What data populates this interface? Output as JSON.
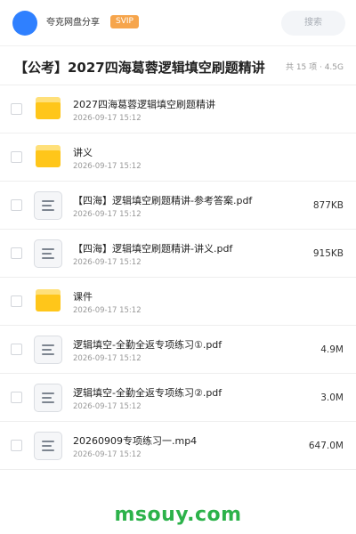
{
  "header": {
    "app_name": "夸克网盘分享",
    "badge": "SVIP",
    "search_placeholder": "搜索"
  },
  "share": {
    "title": "【公考】2027四海葛蓉逻辑填空刷题精讲",
    "meta": "共 15 项 · 4.5G"
  },
  "files": [
    {
      "type": "folder",
      "icon": "folder-icon",
      "name": "2027四海葛蓉逻辑填空刷题精讲",
      "time": "2026-09-17 15:12",
      "size": ""
    },
    {
      "type": "folder",
      "icon": "folder-icon",
      "name": "讲义",
      "time": "2026-09-17 15:12",
      "size": ""
    },
    {
      "type": "file",
      "icon": "document-icon",
      "name": "【四海】逻辑填空刷题精讲-参考答案.pdf",
      "time": "2026-09-17 15:12",
      "size": "877KB"
    },
    {
      "type": "file",
      "icon": "document-icon",
      "name": "【四海】逻辑填空刷题精讲-讲义.pdf",
      "time": "2026-09-17 15:12",
      "size": "915KB"
    },
    {
      "type": "folder",
      "icon": "folder-icon",
      "name": "课件",
      "time": "2026-09-17 15:12",
      "size": ""
    },
    {
      "type": "file",
      "icon": "document-icon",
      "name": "逻辑填空-全勤全返专项练习①.pdf",
      "time": "2026-09-17 15:12",
      "size": "4.9M"
    },
    {
      "type": "file",
      "icon": "document-icon",
      "name": "逻辑填空-全勤全返专项练习②.pdf",
      "time": "2026-09-17 15:12",
      "size": "3.0M"
    },
    {
      "type": "file",
      "icon": "document-icon",
      "name": "20260909专项练习一.mp4",
      "time": "2026-09-17 15:12",
      "size": "647.0M"
    }
  ],
  "watermark": "msouy.com",
  "colors": {
    "accent": "#2f80ff",
    "badge": "#f6a54c",
    "folder": "#ffc61a",
    "watermark": "#2cb24a"
  }
}
